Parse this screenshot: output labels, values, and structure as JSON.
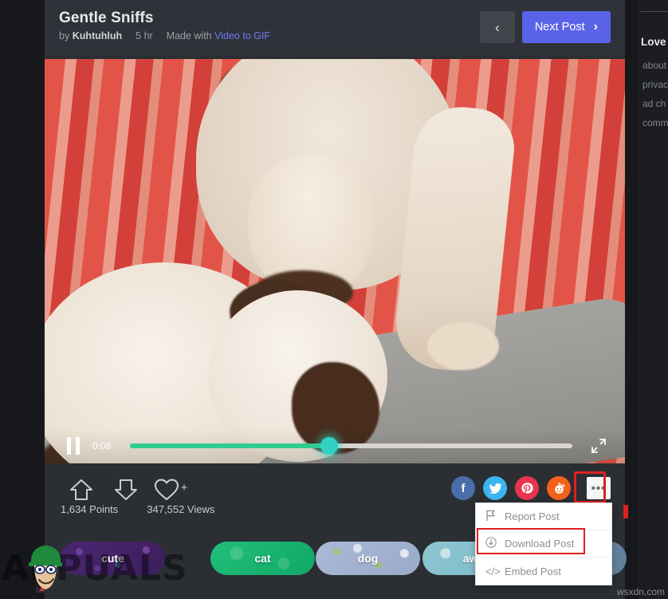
{
  "post": {
    "title": "Gentle Sniffs",
    "by_prefix": "by",
    "author": "Kuhtuhluh",
    "age": "5 hr",
    "made_with_prefix": "Made with",
    "made_with_tool": "Video to GIF"
  },
  "header": {
    "prev_label": "‹",
    "next_label": "Next Post",
    "next_chevron": "›",
    "next_bg": "#5a63e8"
  },
  "player": {
    "state": "paused",
    "current_time": "0:08",
    "progress_percent": 45,
    "fill_color": "#2ecc8f",
    "knob_color": "#32d1c4",
    "pause_icon": "pause-icon",
    "fullscreen_icon": "fullscreen-icon"
  },
  "actions": {
    "upvote_icon": "upvote-arrow-icon",
    "downvote_icon": "downvote-arrow-icon",
    "favorite_icon": "heart-icon",
    "favorite_plus": "+",
    "points": "1,634 Points",
    "views": "347,552 Views"
  },
  "share": {
    "items": [
      {
        "name": "facebook",
        "glyph": "f",
        "color": "#4a6ea9"
      },
      {
        "name": "twitter",
        "glyph": "ᵛ",
        "color": "#3cb4ef"
      },
      {
        "name": "pinterest",
        "glyph": "ᴘ",
        "color": "#e8344e"
      },
      {
        "name": "reddit",
        "glyph": "Ⓡ",
        "color": "#f4611a"
      }
    ],
    "more_label": "•••",
    "highlight_color": "#e02020"
  },
  "dropdown": {
    "open": true,
    "items": [
      {
        "label": "Report Post",
        "icon": "flag-icon",
        "glyph": "⚑",
        "highlighted": false
      },
      {
        "label": "Download Post",
        "icon": "download-circle-icon",
        "glyph": "⬇",
        "highlighted": true
      },
      {
        "label": "Embed Post",
        "icon": "code-icon",
        "glyph": "</>",
        "highlighted": false
      }
    ],
    "highlight_color": "#e02020"
  },
  "tags": [
    {
      "label": "cute"
    },
    {
      "label": "cat"
    },
    {
      "label": "dog"
    },
    {
      "label": "aww"
    },
    {
      "label": ""
    }
  ],
  "watermarks": {
    "appuals": "APPUALS",
    "site": "wsxdn.com"
  },
  "right_rail": {
    "title": "Love",
    "links": [
      "about",
      "privac",
      "ad ch",
      "comm"
    ]
  }
}
